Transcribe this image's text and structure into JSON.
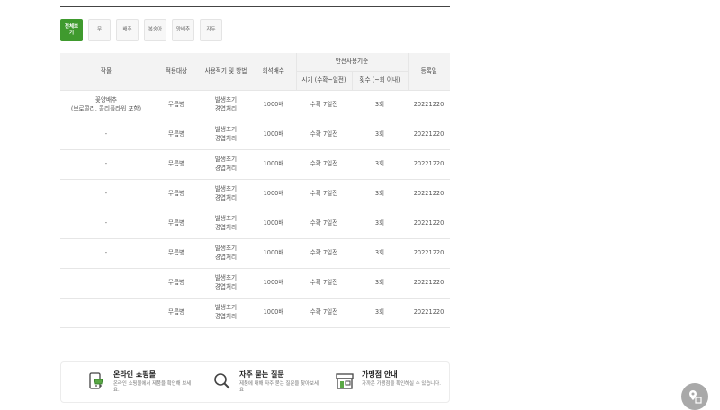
{
  "tabs": [
    {
      "label": "전체보기",
      "active": true
    },
    {
      "label": "무",
      "active": false
    },
    {
      "label": "배추",
      "active": false
    },
    {
      "label": "복숭아",
      "active": false
    },
    {
      "label": "양배추",
      "active": false
    },
    {
      "label": "자두",
      "active": false
    }
  ],
  "table": {
    "headers": {
      "crop": "작물",
      "target": "적용대상",
      "method": "사용적기 및 방법",
      "dilution": "희석배수",
      "safety": "안전사용기준",
      "timing": "시기 (수확~일전)",
      "count": "횟수 (~회 이내)",
      "date": "등록일"
    },
    "rows": [
      {
        "crop": "꽃양배추\n(브로콜리, 콜리플라워 포함)",
        "target": "무름병",
        "method": "발생초기\n경엽처리",
        "dilution": "1000배",
        "timing": "수확 7일전",
        "count": "3회",
        "date": "20221220"
      },
      {
        "crop": "-",
        "target": "무름병",
        "method": "발생초기\n경엽처리",
        "dilution": "1000배",
        "timing": "수확 7일전",
        "count": "3회",
        "date": "20221220"
      },
      {
        "crop": "-",
        "target": "무름병",
        "method": "발생초기\n경엽처리",
        "dilution": "1000배",
        "timing": "수확 7일전",
        "count": "3회",
        "date": "20221220"
      },
      {
        "crop": "-",
        "target": "무름병",
        "method": "발생초기\n경엽처리",
        "dilution": "1000배",
        "timing": "수확 7일전",
        "count": "3회",
        "date": "20221220"
      },
      {
        "crop": "-",
        "target": "무름병",
        "method": "발생초기\n경엽처리",
        "dilution": "1000배",
        "timing": "수확 7일전",
        "count": "3회",
        "date": "20221220"
      },
      {
        "crop": "-",
        "target": "무름병",
        "method": "발생초기\n경엽처리",
        "dilution": "1000배",
        "timing": "수확 7일전",
        "count": "3회",
        "date": "20221220"
      },
      {
        "crop": "",
        "target": "무름병",
        "method": "발생초기\n경엽처리",
        "dilution": "1000배",
        "timing": "수확 7일전",
        "count": "3회",
        "date": "20221220"
      },
      {
        "crop": "",
        "target": "무름병",
        "method": "발생초기\n경엽처리",
        "dilution": "1000배",
        "timing": "수확 7일전",
        "count": "3회",
        "date": "20221220"
      }
    ]
  },
  "footer": {
    "shop": {
      "title": "온라인 쇼핑몰",
      "desc": "온라인 쇼핑몰에서 제품을 확인해 보세요.",
      "icon": "mobile-shop-icon"
    },
    "faq": {
      "title": "자주 묻는 질문",
      "desc": "제품에 대해 자주 묻는 질문을 찾아보세요",
      "icon": "search-icon"
    },
    "store": {
      "title": "가맹점 안내",
      "desc": "가까운 가맹점을 확인하실 수 있습니다.",
      "icon": "store-icon"
    }
  },
  "floating_button": {
    "icon": "map-pin-icon"
  },
  "colors": {
    "accent": "#3f9a2e",
    "header_bg": "#f3f3f3",
    "border": "#e6e6e6"
  }
}
